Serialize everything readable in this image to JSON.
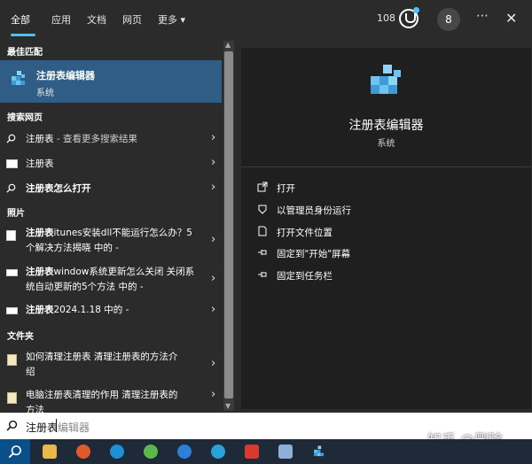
{
  "tabs": [
    "全部",
    "应用",
    "文档",
    "网页",
    "更多"
  ],
  "more_chevron": "▾",
  "header": {
    "points": "108",
    "avatar_initial": "8",
    "more_icon": "⋯",
    "close_icon": "✕"
  },
  "left": {
    "best_match_title": "最佳匹配",
    "best_match": {
      "name": "注册表编辑器",
      "type": "系统"
    },
    "web_title": "搜索网页",
    "web_items": [
      {
        "bold": "注册表",
        "rest": " - 查看更多搜索结果"
      },
      {
        "bold": "注册表",
        "rest": ""
      },
      {
        "bold": "注册表怎么打开",
        "rest": ""
      }
    ],
    "photos_title": "照片",
    "photo_items": [
      {
        "bold": "注册表",
        "line1_rest": "itunes安装dll不能运行怎么办？5",
        "line2": "个解决方法揭晓 中的 -"
      },
      {
        "bold": "注册表",
        "line1_rest": "window系统更新怎么关闭 关闭系",
        "line2": "统自动更新的5个方法 中的 -"
      },
      {
        "bold": "注册表",
        "line1_rest": "2024.1.18 中的 -",
        "line2": ""
      }
    ],
    "docs_title": "文件夹",
    "doc_items": [
      {
        "line1": "如何清理注册表 清理注册表的方法介",
        "line2": "绍"
      },
      {
        "line1": "电脑注册表清理的作用 清理注册表的",
        "line2": "方法"
      }
    ],
    "chevron": "›"
  },
  "right": {
    "app_name": "注册表编辑器",
    "app_type": "系统",
    "actions": [
      "打开",
      "以管理员身份运行",
      "打开文件位置",
      "固定到\"开始\"屏幕",
      "固定到任务栏"
    ]
  },
  "search": {
    "typed": "注册表",
    "ghost": "编辑器"
  },
  "watermark": "知乎 @删除",
  "colors": {
    "accent": "#4cc2ff",
    "selected": "#2f5d86",
    "taskbar": "#1e2a38"
  }
}
